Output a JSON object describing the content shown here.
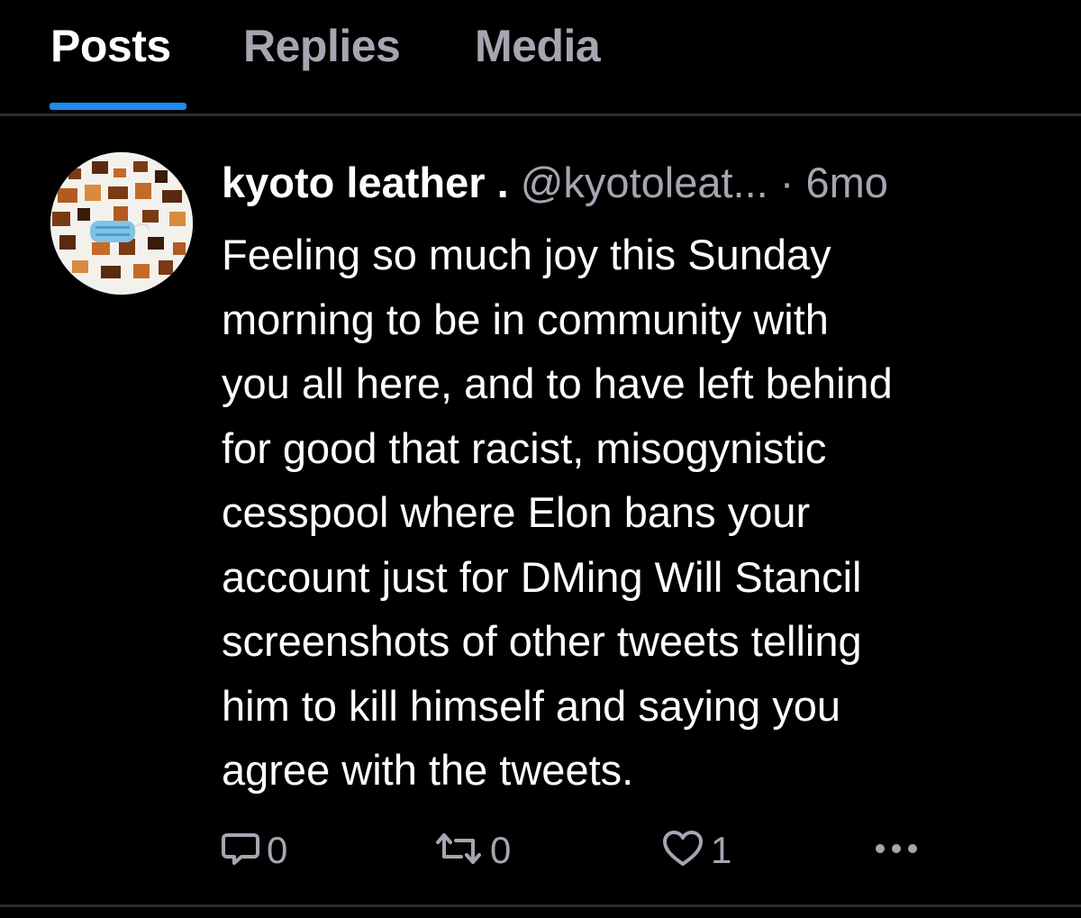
{
  "tabs": {
    "posts": "Posts",
    "replies": "Replies",
    "media": "Media"
  },
  "colors": {
    "accent": "#1d8bf1",
    "muted": "#a6a6b2"
  },
  "post": {
    "display_name": "kyoto leather .",
    "handle": "@kyotoleat...",
    "separator": "·",
    "time": "6mo",
    "text": "Feeling so much joy this Sunday\nmorning to be in community with\nyou all here, and to have left behind\nfor good that racist, misogynistic\ncesspool where Elon bans your\naccount just for DMing Will Stancil\nscreenshots of other tweets telling\nhim to kill himself and saying you\nagree with the tweets.",
    "actions": {
      "reply_count": "0",
      "repost_count": "0",
      "like_count": "1",
      "reply_icon": "reply-icon",
      "repost_icon": "repost-icon",
      "like_icon": "heart-icon",
      "more_icon": "more-icon"
    }
  }
}
